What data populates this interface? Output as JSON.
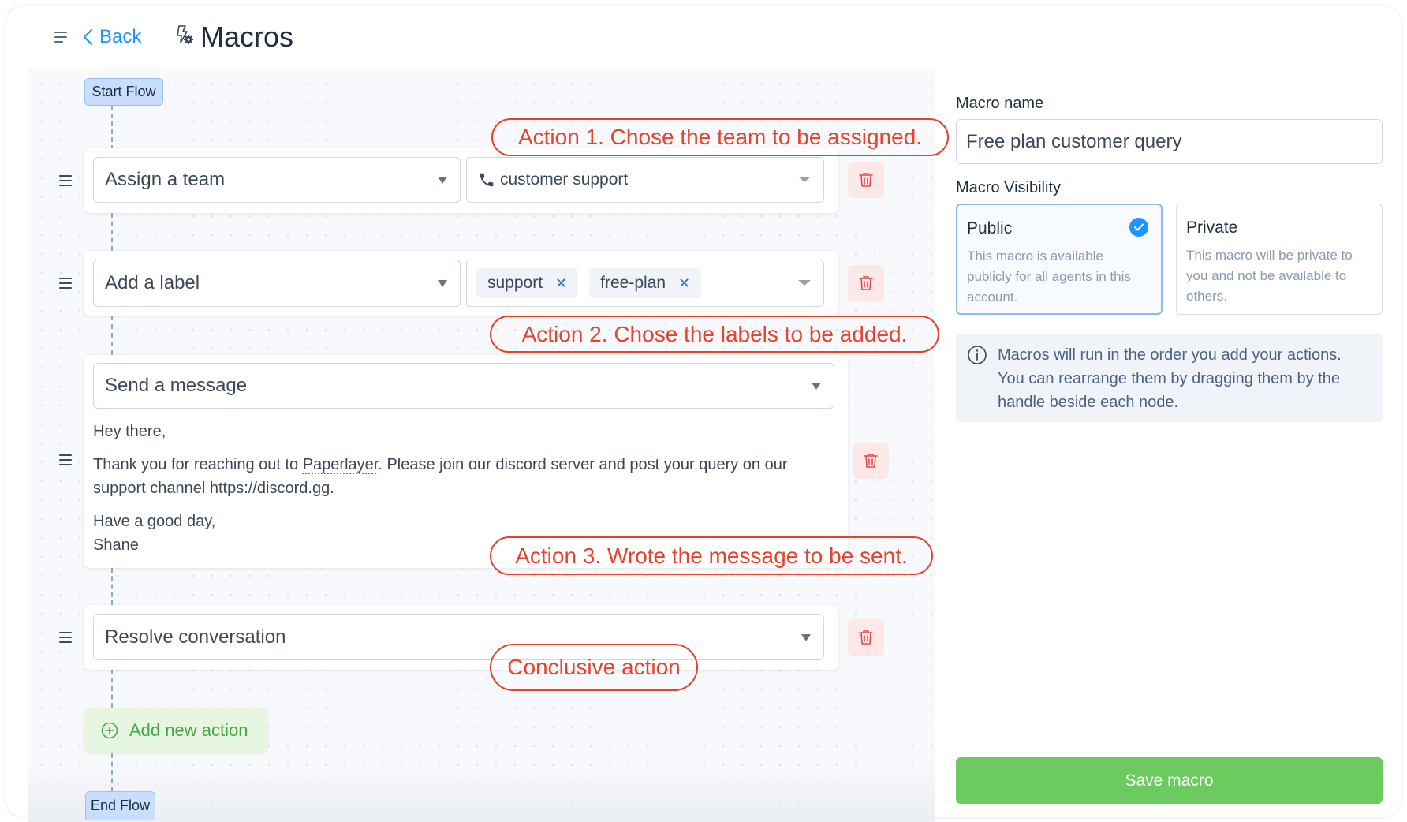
{
  "header": {
    "menu_icon": "hamburger-icon",
    "back_label": "Back",
    "page_icon": "macro-bolt-gear-icon",
    "title": "Macros"
  },
  "flow": {
    "start_label": "Start Flow",
    "end_label": "End Flow",
    "add_action_label": "Add new action",
    "actions": [
      {
        "type": "Assign a team",
        "value": "customer support",
        "value_icon": "phone-icon"
      },
      {
        "type": "Add a label",
        "labels": [
          "support",
          "free-plan"
        ]
      },
      {
        "type": "Send a message",
        "message": {
          "greeting": "Hey there,",
          "body_before": "Thank you for reaching out to ",
          "body_brand": "Paperlayer",
          "body_after": ". Please join our discord server and post your query on our support channel https://discord.gg.",
          "signoff": "Have a good day,",
          "name": "Shane"
        }
      },
      {
        "type": "Resolve conversation"
      }
    ]
  },
  "annotations": [
    "Action 1. Chose the team to be assigned.",
    "Action 2. Chose the labels to be added.",
    "Action 3. Wrote the message to be sent.",
    "Conclusive action"
  ],
  "panel": {
    "name_label": "Macro name",
    "name_value": "Free plan customer query",
    "visibility_label": "Macro Visibility",
    "visibility_options": [
      {
        "title": "Public",
        "description": "This macro is available publicly for all agents in this account.",
        "selected": true
      },
      {
        "title": "Private",
        "description": "This macro will be private to you and not be available to others.",
        "selected": false
      }
    ],
    "info_text": "Macros will run in the order you add your actions. You can rearrange them by dragging them by the handle beside each node.",
    "save_label": "Save macro"
  },
  "colors": {
    "accent_blue": "#1f93ff",
    "save_green": "#6ccb5f",
    "annotation_red": "#e8412c",
    "delete_red": "#e5484d"
  }
}
